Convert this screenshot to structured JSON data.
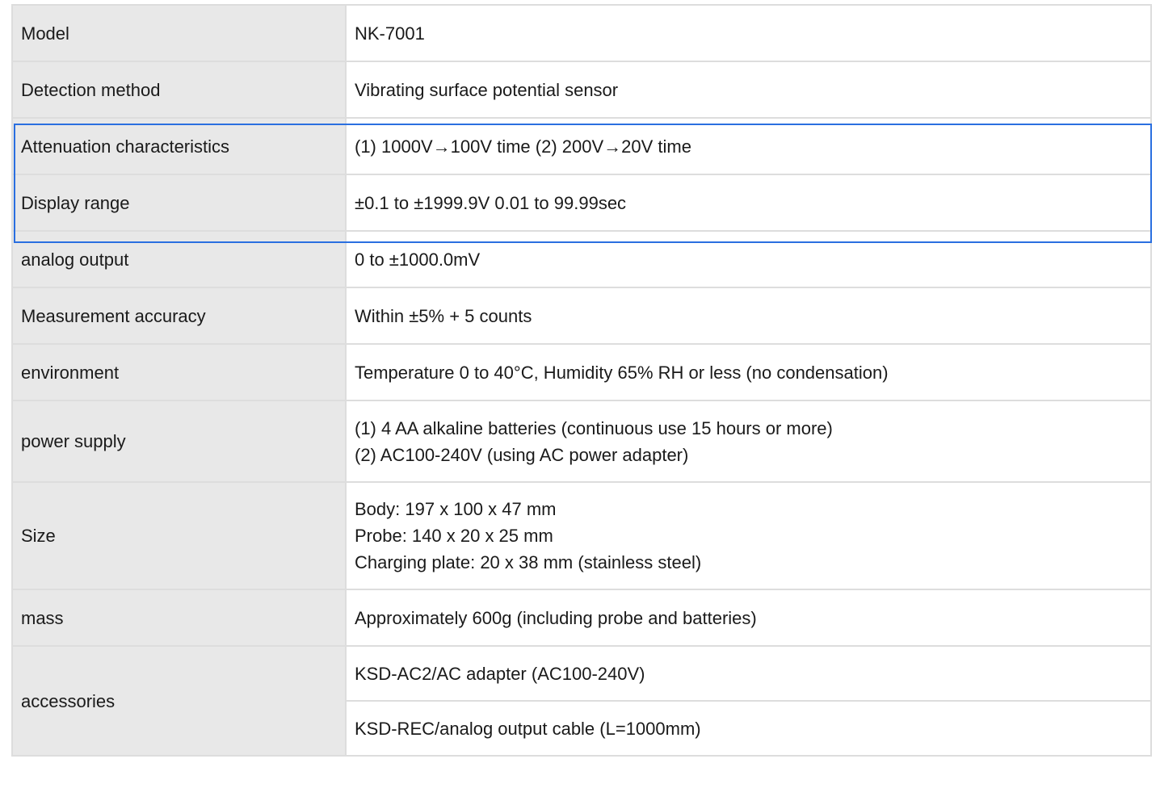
{
  "rows": [
    {
      "label": "Model",
      "value": "NK-7001"
    },
    {
      "label": "Detection method",
      "value": "Vibrating surface potential sensor"
    },
    {
      "label": "Attenuation characteristics",
      "value": "(1) 1000V→100V time (2) 200V→20V time"
    },
    {
      "label": "Display range",
      "value": "±0.1 to ±1999.9V 0.01 to 99.99sec"
    },
    {
      "label": "analog output",
      "value": "0 to ±1000.0mV"
    },
    {
      "label": "Measurement accuracy",
      "value": "Within ±5% + 5 counts"
    },
    {
      "label": "environment",
      "value": "Temperature 0 to 40°C, Humidity 65% RH or less (no condensation)"
    },
    {
      "label": "power supply",
      "lines": [
        "(1) 4 AA alkaline batteries (continuous use 15 hours or more)",
        "(2) AC100-240V (using AC power adapter)"
      ]
    },
    {
      "label": "Size",
      "lines": [
        "Body: 197 x 100 x 47 mm",
        "Probe: 140 x 20 x 25 mm",
        "Charging plate: 20 x 38 mm (stainless steel)"
      ]
    },
    {
      "label": "mass",
      "value": "Approximately 600g (including probe and batteries)"
    },
    {
      "label": "accessories",
      "values": [
        "KSD-AC2/AC adapter (AC100-240V)",
        "KSD-REC/analog output cable (L=1000mm)"
      ]
    }
  ],
  "highlight": {
    "color": "#2a6fe0",
    "rows": [
      "Attenuation characteristics",
      "Display range"
    ]
  }
}
